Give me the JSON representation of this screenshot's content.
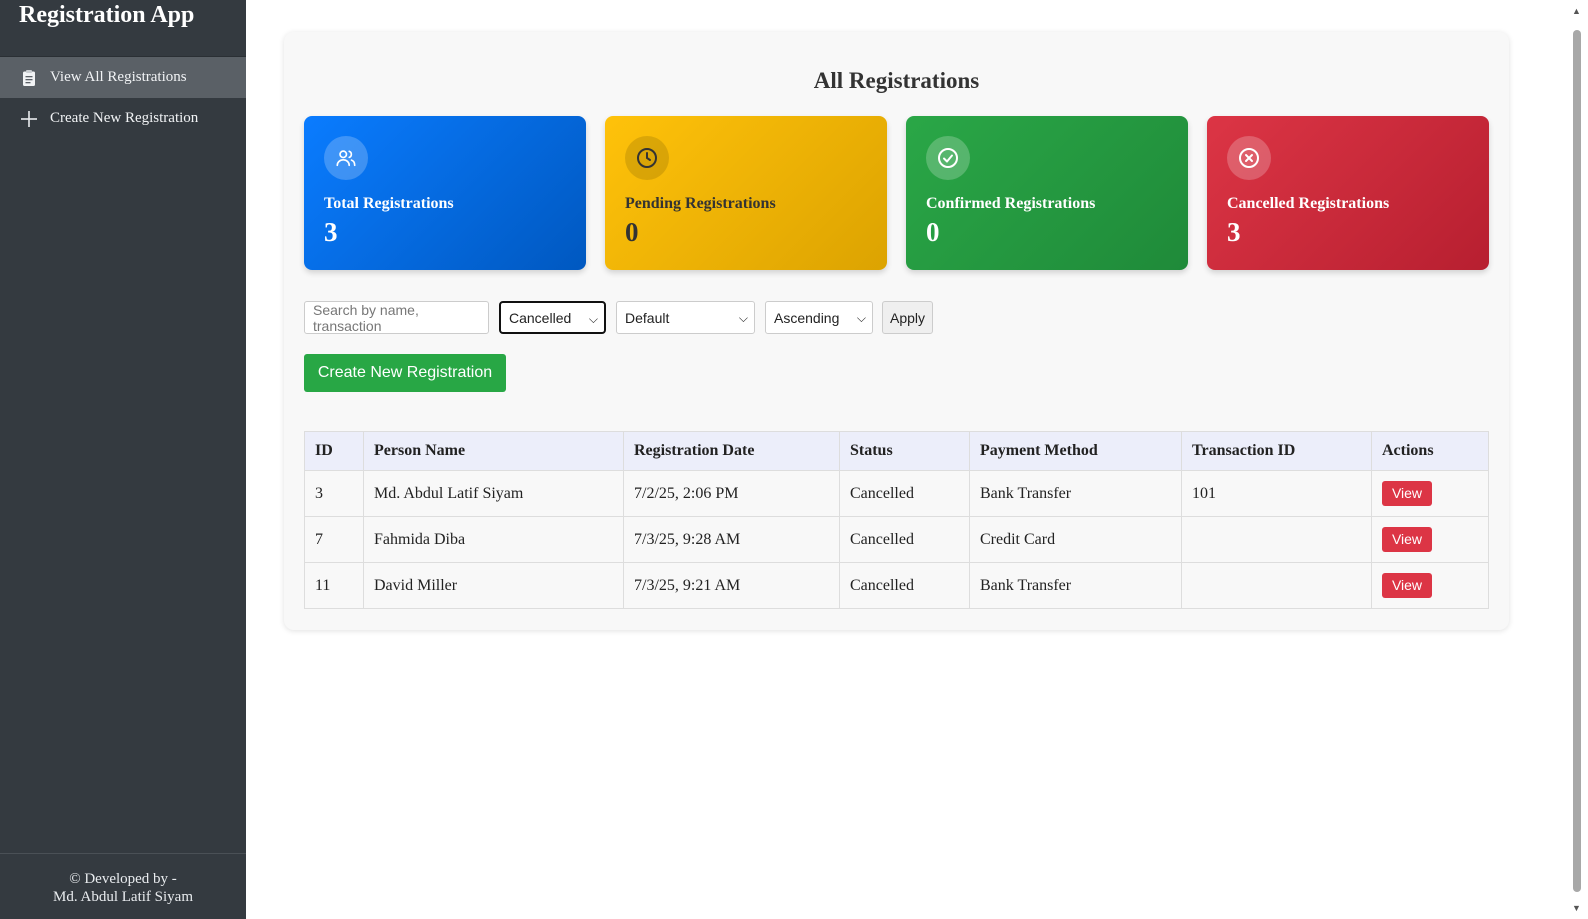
{
  "sidebar": {
    "brand": "Registration App",
    "items": [
      {
        "label": "View All Registrations",
        "icon": "clipboard-icon",
        "active": true
      },
      {
        "label": "Create New Registration",
        "icon": "plus-icon",
        "active": false
      }
    ],
    "footer_line1": "© Developed by -",
    "footer_line2": "Md. Abdul Latif Siyam"
  },
  "main": {
    "title": "All Registrations",
    "stats": [
      {
        "label": "Total Registrations",
        "value": "3",
        "icon": "users-icon",
        "color": "#0a7cff"
      },
      {
        "label": "Pending Registrations",
        "value": "0",
        "icon": "clock-icon",
        "color": "#ffc20a"
      },
      {
        "label": "Confirmed Registrations",
        "value": "0",
        "icon": "check-circle-icon",
        "color": "#28a745"
      },
      {
        "label": "Cancelled Registrations",
        "value": "3",
        "icon": "x-circle-icon",
        "color": "#dc3545"
      }
    ],
    "filters": {
      "search_placeholder": "Search by name, transaction",
      "status_selected": "Cancelled",
      "sort_selected": "Default",
      "order_selected": "Ascending",
      "apply_label": "Apply"
    },
    "create_button": "Create New Registration",
    "table": {
      "headers": [
        "ID",
        "Person Name",
        "Registration Date",
        "Status",
        "Payment Method",
        "Transaction ID",
        "Actions"
      ],
      "rows": [
        {
          "id": "3",
          "name": "Md. Abdul Latif Siyam",
          "date": "7/2/25, 2:06 PM",
          "status": "Cancelled",
          "payment": "Bank Transfer",
          "txn": "101",
          "action": "View"
        },
        {
          "id": "7",
          "name": "Fahmida Diba",
          "date": "7/3/25, 9:28 AM",
          "status": "Cancelled",
          "payment": "Credit Card",
          "txn": "",
          "action": "View"
        },
        {
          "id": "11",
          "name": "David Miller",
          "date": "7/3/25, 9:21 AM",
          "status": "Cancelled",
          "payment": "Bank Transfer",
          "txn": "",
          "action": "View"
        }
      ]
    }
  }
}
